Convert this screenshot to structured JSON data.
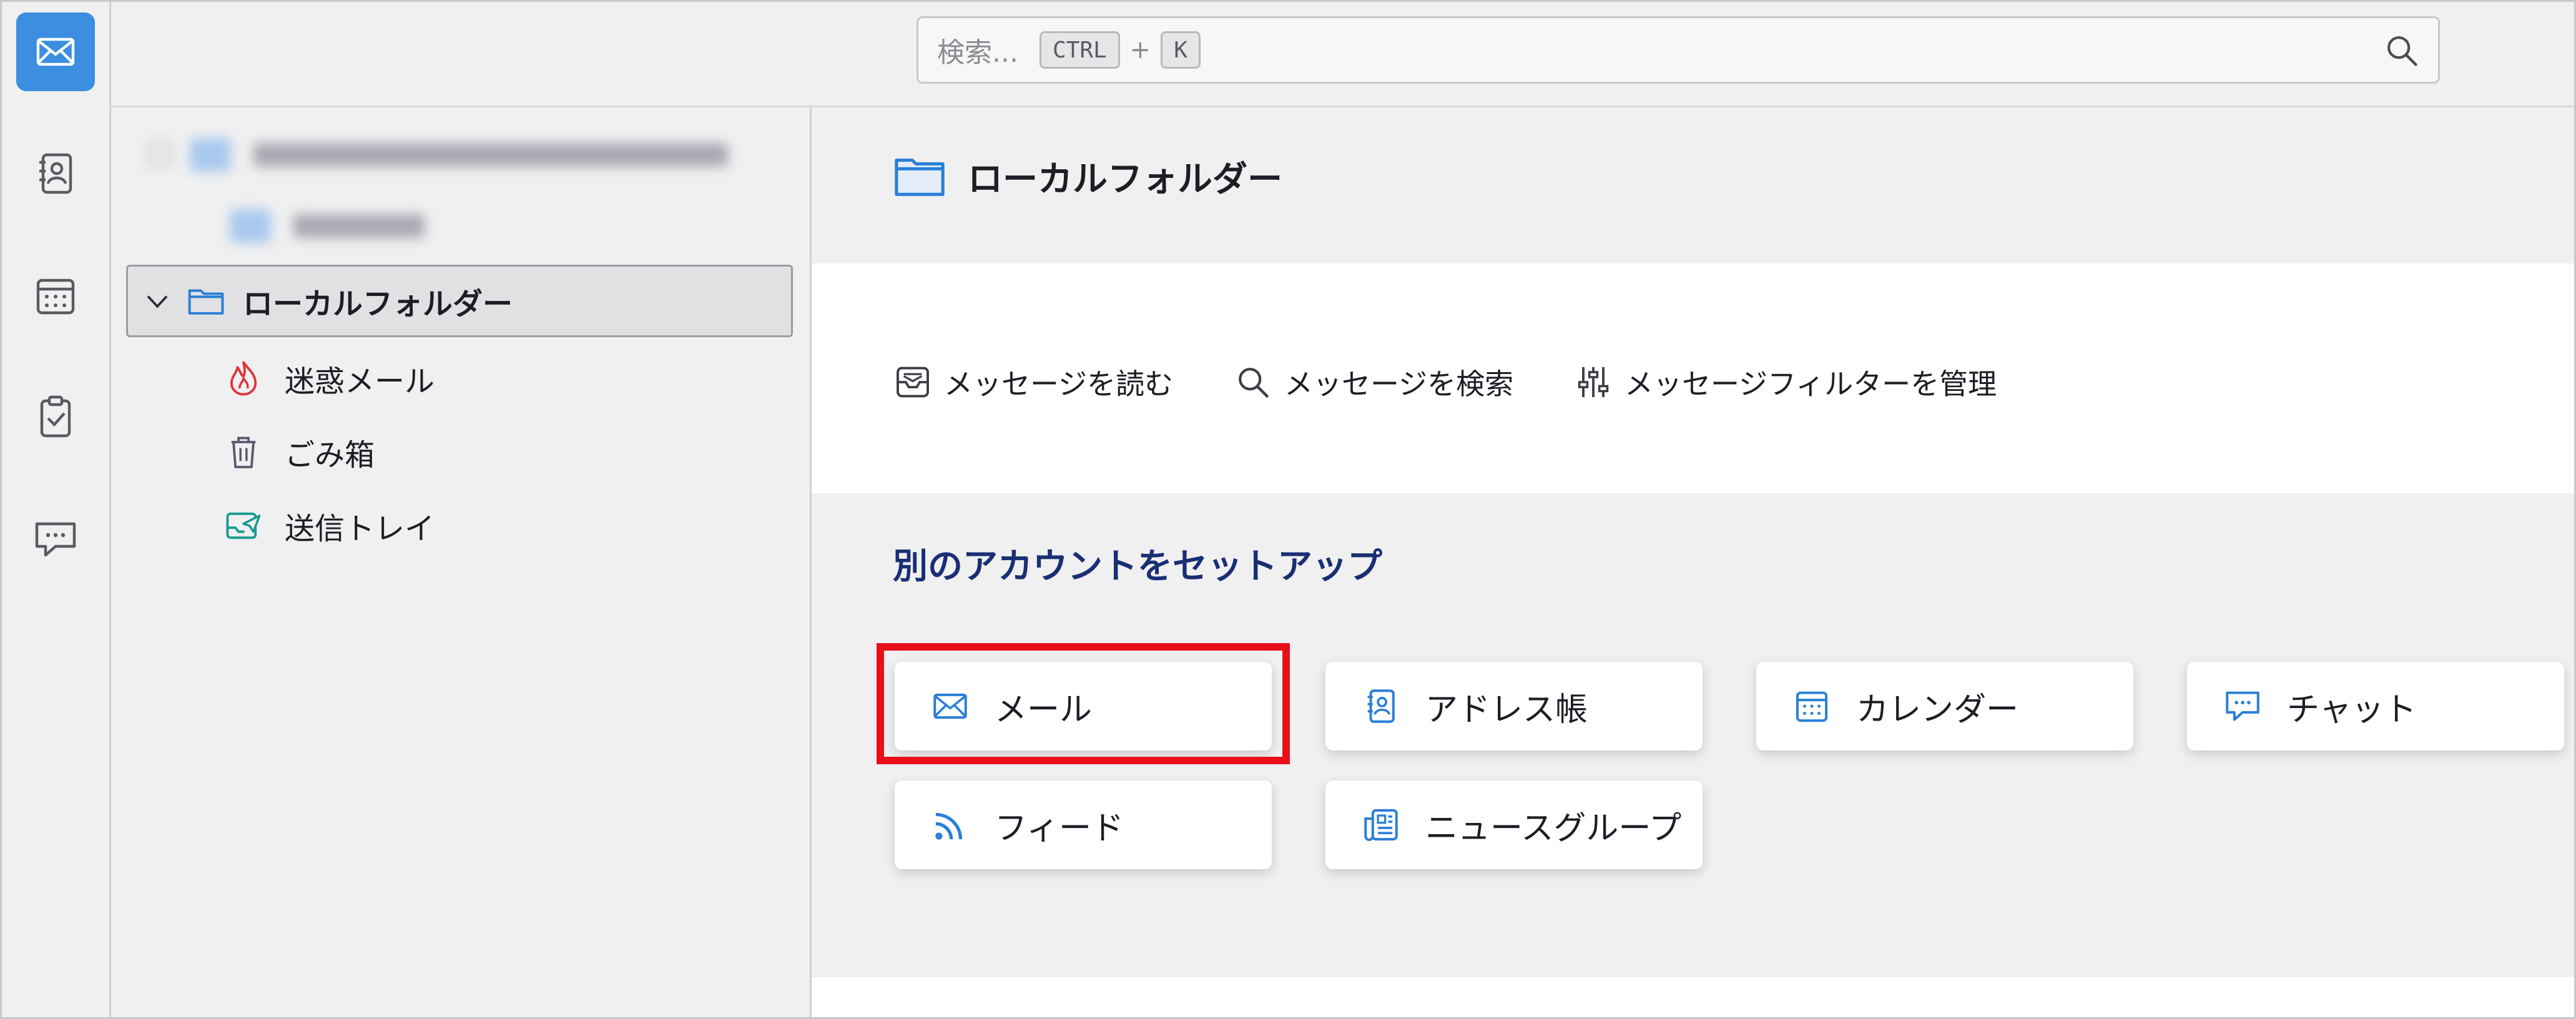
{
  "spaces": {
    "items": [
      {
        "name": "mail",
        "icon": "mail-icon",
        "active": true
      },
      {
        "name": "address-book",
        "icon": "address-book-icon",
        "active": false
      },
      {
        "name": "calendar",
        "icon": "calendar-icon",
        "active": false
      },
      {
        "name": "tasks",
        "icon": "tasks-icon",
        "active": false
      },
      {
        "name": "chat",
        "icon": "chat-icon",
        "active": false
      }
    ]
  },
  "search": {
    "placeholder": "検索...",
    "shortcut_key1": "CTRL",
    "shortcut_plus": "+",
    "shortcut_key2": "K"
  },
  "folder_pane": {
    "local_folders_label": "ローカルフォルダー",
    "items": [
      {
        "label": "迷惑メール",
        "icon": "junk-icon"
      },
      {
        "label": "ごみ箱",
        "icon": "trash-icon"
      },
      {
        "label": "送信トレイ",
        "icon": "outbox-icon"
      }
    ]
  },
  "main": {
    "title": "ローカルフォルダー",
    "actions": [
      {
        "label": "メッセージを読む",
        "icon": "read-messages-icon"
      },
      {
        "label": "メッセージを検索",
        "icon": "search-icon"
      },
      {
        "label": "メッセージフィルターを管理",
        "icon": "filter-icon"
      }
    ],
    "setup_title": "別のアカウントをセットアップ",
    "setup_cards": [
      {
        "label": "メール",
        "icon": "mail-icon",
        "highlighted": true
      },
      {
        "label": "アドレス帳",
        "icon": "address-book-icon"
      },
      {
        "label": "カレンダー",
        "icon": "calendar-icon"
      },
      {
        "label": "チャット",
        "icon": "chat-icon"
      },
      {
        "label": "フィード",
        "icon": "feed-icon"
      },
      {
        "label": "ニュースグループ",
        "icon": "newsgroup-icon"
      }
    ]
  },
  "colors": {
    "accent": "#3b8ee0",
    "icon_blue": "#2a7fd6",
    "highlight_red": "#e8101a",
    "setup_title": "#1a2f73"
  }
}
